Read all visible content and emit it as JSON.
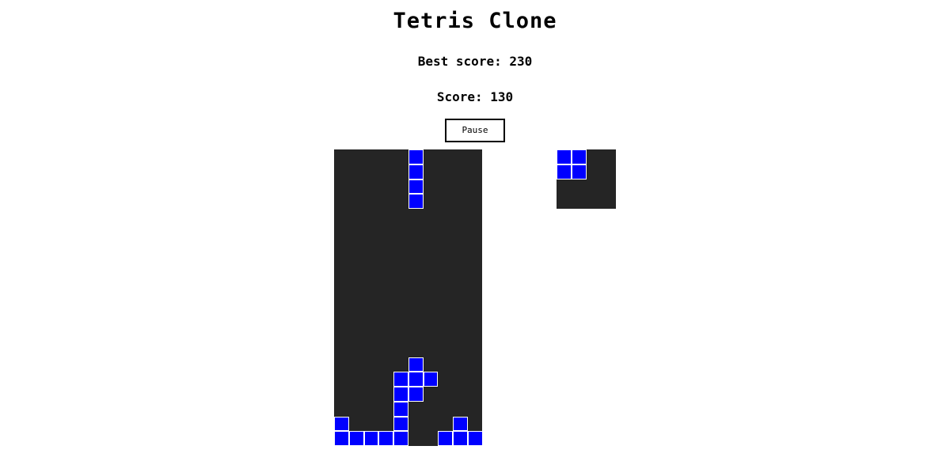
{
  "game": {
    "title": "Tetris Clone",
    "best_score_text": "Best score: 230",
    "score_text": "Score: 130",
    "pause_label": "Pause"
  },
  "board": {
    "columns": 10,
    "rows": 20,
    "block_color": "#0000ff",
    "background_color": "#252525",
    "falling_piece": [
      [
        5,
        0
      ],
      [
        5,
        1
      ],
      [
        5,
        2
      ],
      [
        5,
        3
      ]
    ],
    "settled_blocks": [
      [
        5,
        14
      ],
      [
        4,
        15
      ],
      [
        5,
        15
      ],
      [
        6,
        15
      ],
      [
        4,
        16
      ],
      [
        5,
        16
      ],
      [
        4,
        17
      ],
      [
        0,
        18
      ],
      [
        4,
        18
      ],
      [
        8,
        18
      ],
      [
        0,
        19
      ],
      [
        1,
        19
      ],
      [
        2,
        19
      ],
      [
        3,
        19
      ],
      [
        4,
        19
      ],
      [
        7,
        19
      ],
      [
        8,
        19
      ],
      [
        9,
        19
      ]
    ]
  },
  "next_piece": {
    "columns": 4,
    "rows": 4,
    "block_color": "#0000ff",
    "blocks": [
      [
        0,
        0
      ],
      [
        1,
        0
      ],
      [
        0,
        1
      ],
      [
        1,
        1
      ]
    ]
  }
}
